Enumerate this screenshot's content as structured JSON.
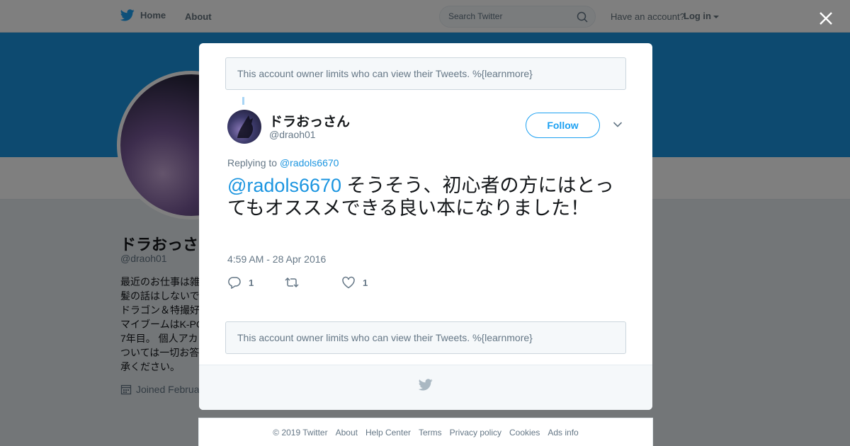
{
  "nav": {
    "home_label": "Home",
    "about_label": "About",
    "search_placeholder": "Search Twitter",
    "have_account": "Have an account?",
    "login_label": "Log in"
  },
  "profile": {
    "name": "ドラおっさ",
    "handle": "@draoh01",
    "bio_lines": [
      "最近のお仕事は雑",
      "髪の話はしないで",
      "ドラゴン＆特撮好",
      "マイブームはK-PO",
      "7年目。 個人アカ",
      "ついては一切お答",
      "承ください。"
    ],
    "joined": "Joined Februa"
  },
  "modal": {
    "notice": "This account owner limits who can view their Tweets. %{learnmore}",
    "tweet": {
      "name": "ドラおっさん",
      "handle": "@draoh01",
      "follow_label": "Follow",
      "replying_prefix": "Replying to ",
      "replying_to": "@radols6670",
      "mention": "@radols6670",
      "text": " そうそう、初心者の方にはとってもオススメできる良い本になりました！",
      "timestamp": "4:59 AM - 28 Apr 2016",
      "reply_count": "1",
      "retweet_count": "",
      "like_count": "1"
    }
  },
  "footer": {
    "links": [
      "© 2019 Twitter",
      "About",
      "Help Center",
      "Terms",
      "Privacy policy",
      "Cookies",
      "Ads info"
    ]
  },
  "icons": {
    "logo": "twitter-bird-icon",
    "search": "search-icon",
    "close": "close-icon",
    "more": "chevron-down-icon",
    "reply": "reply-icon",
    "retweet": "retweet-icon",
    "like": "heart-icon",
    "calendar": "calendar-icon"
  },
  "colors": {
    "brand": "#1da1f2",
    "link": "#1b95e0",
    "banner": "#1b95e0"
  }
}
